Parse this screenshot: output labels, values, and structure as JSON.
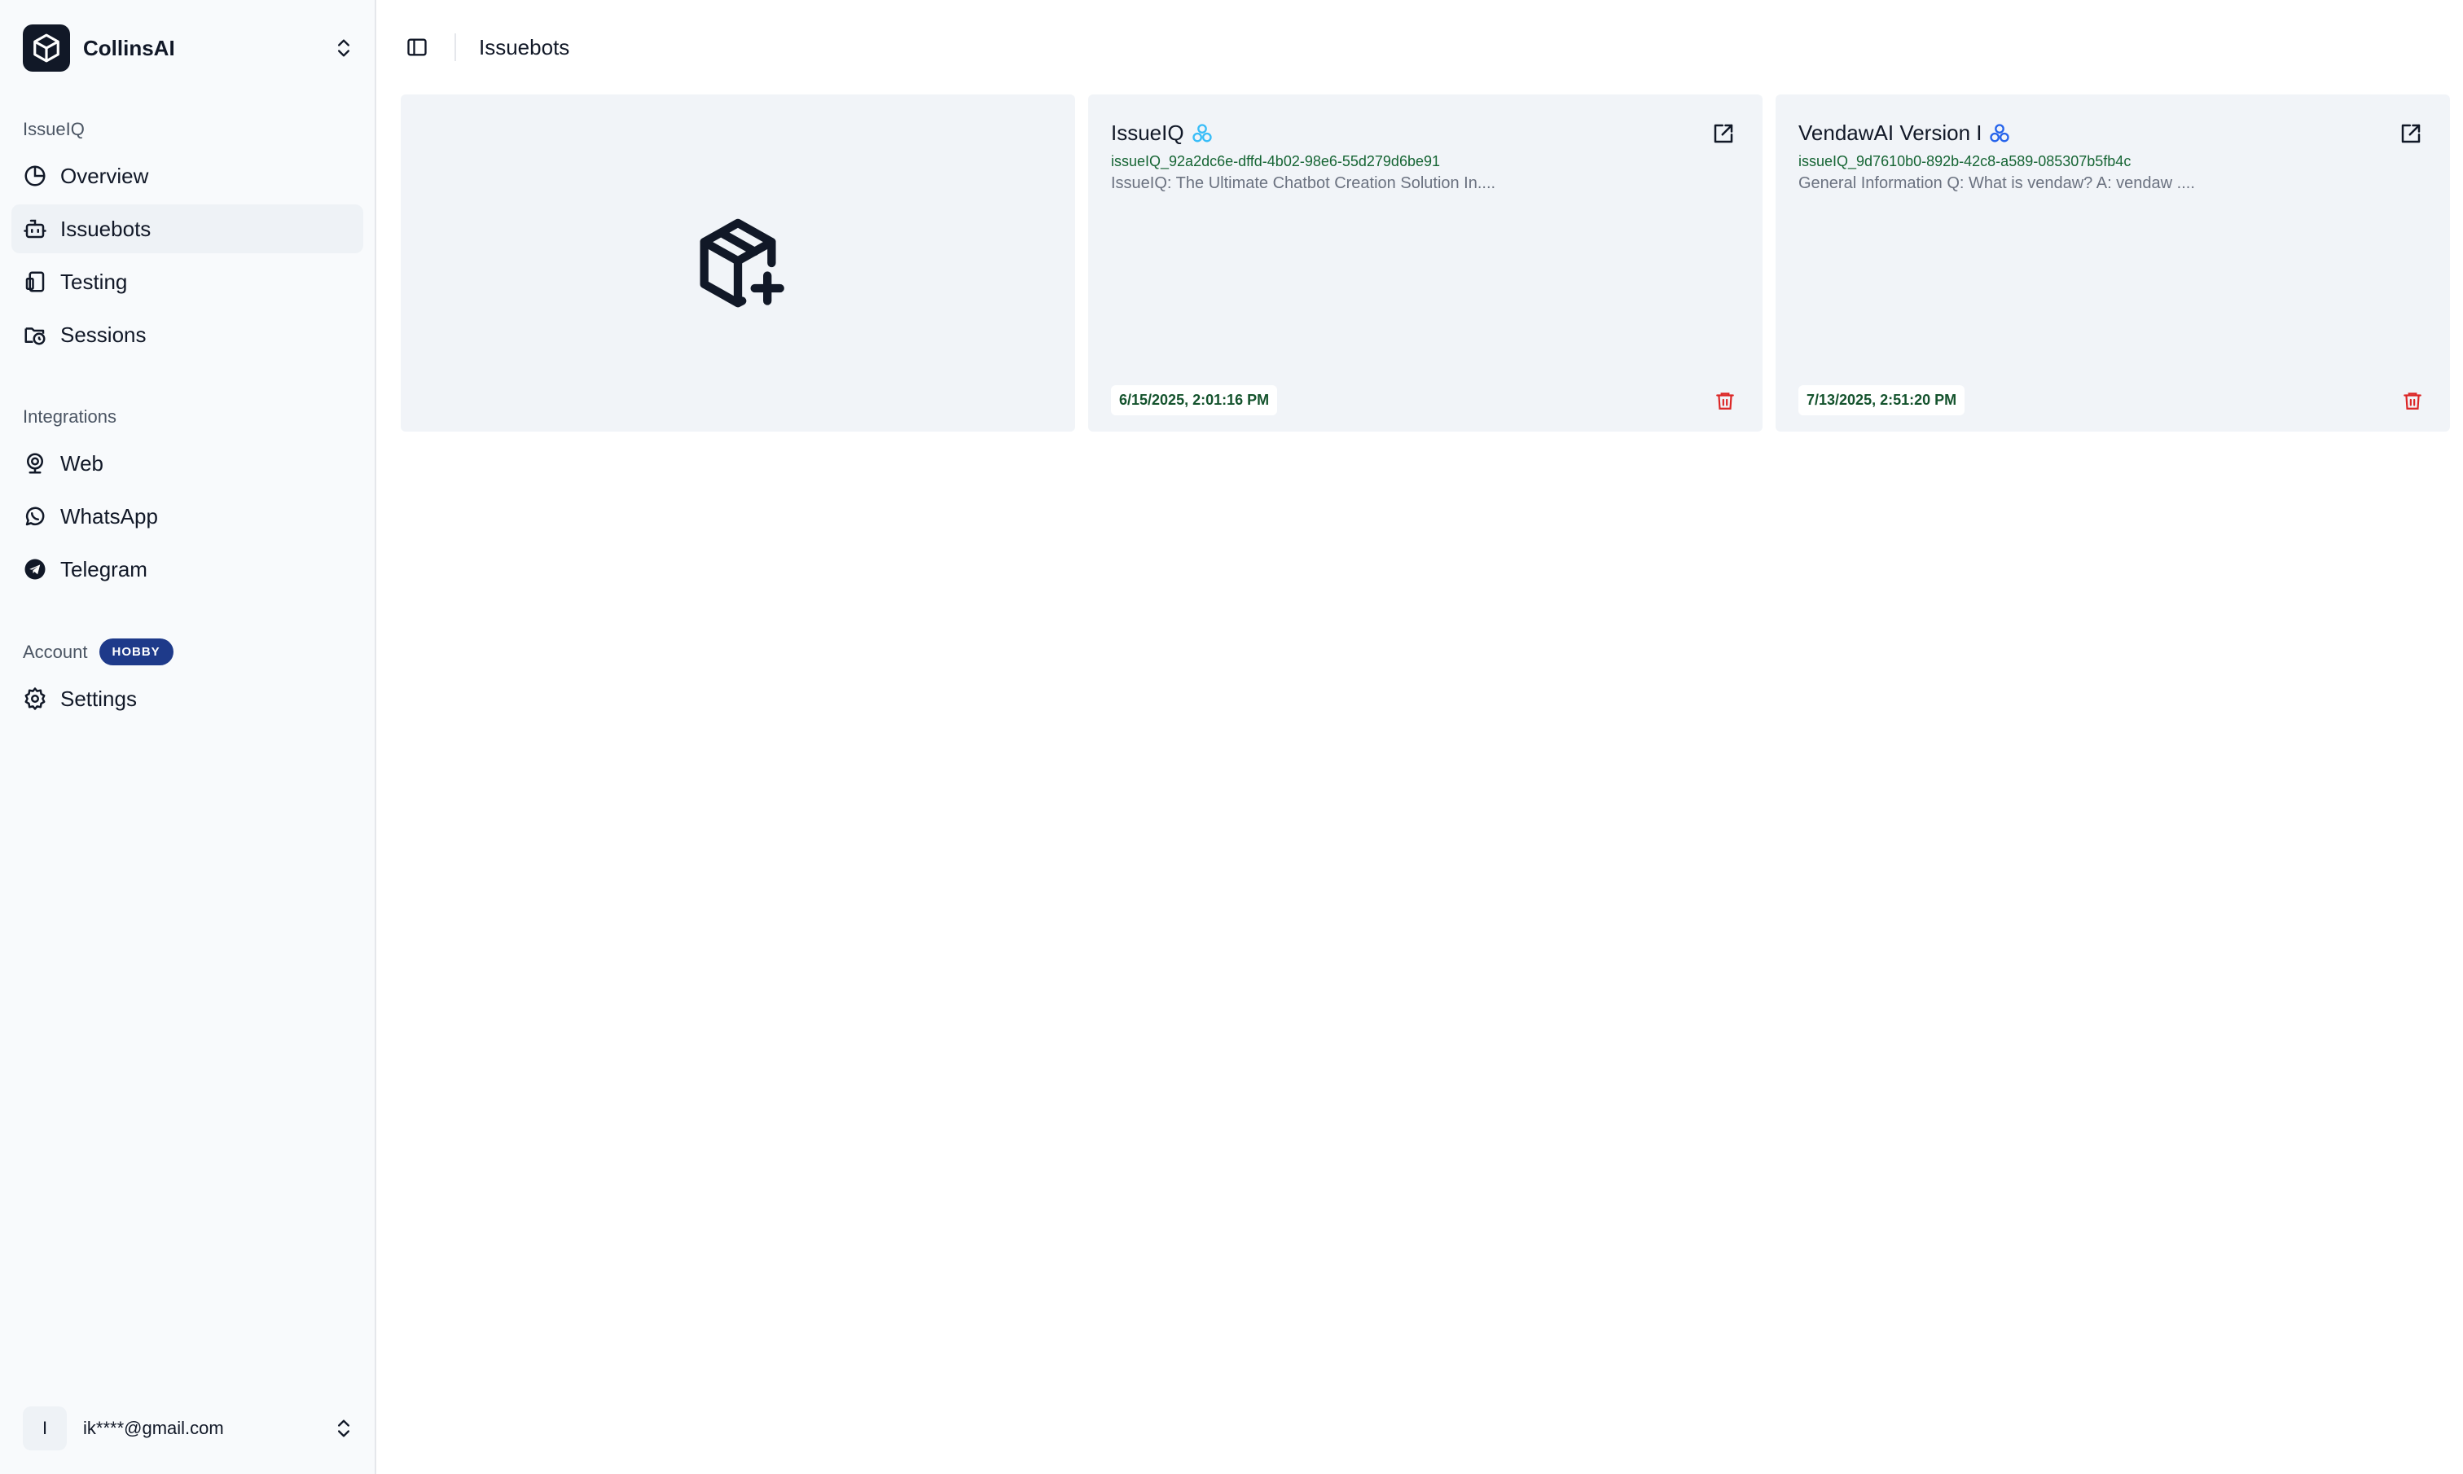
{
  "workspace": {
    "name": "CollinsAI"
  },
  "sidebar": {
    "sections": [
      {
        "label": "IssueIQ"
      },
      {
        "label": "Integrations"
      },
      {
        "label": "Account",
        "badge": "HOBBY"
      }
    ],
    "issueiq_items": [
      {
        "label": "Overview",
        "icon": "pie-chart-icon"
      },
      {
        "label": "Issuebots",
        "icon": "bot-icon",
        "active": true
      },
      {
        "label": "Testing",
        "icon": "book-icon"
      },
      {
        "label": "Sessions",
        "icon": "folder-clock-icon"
      }
    ],
    "integration_items": [
      {
        "label": "Web",
        "icon": "webcam-icon"
      },
      {
        "label": "WhatsApp",
        "icon": "whatsapp-icon"
      },
      {
        "label": "Telegram",
        "icon": "telegram-icon"
      }
    ],
    "account_items": [
      {
        "label": "Settings",
        "icon": "gear-icon"
      }
    ],
    "user": {
      "initial": "I",
      "email": "ik****@gmail.com"
    }
  },
  "header": {
    "breadcrumb": "Issuebots"
  },
  "bots": [
    {
      "name": "IssueIQ",
      "id": "issueIQ_92a2dc6e-dffd-4b02-98e6-55d279d6be91",
      "description": "IssueIQ: The Ultimate Chatbot Creation Solution In....",
      "date": "6/15/2025, 2:01:16 PM",
      "icon_color": "#38bdf8"
    },
    {
      "name": "VendawAI Version I",
      "id": "issueIQ_9d7610b0-892b-42c8-a589-085307b5fb4c",
      "description": "General Information Q: What is vendaw? A: vendaw ....",
      "date": "7/13/2025, 2:51:20 PM",
      "icon_color": "#2563eb"
    }
  ],
  "colors": {
    "accent_badge": "#1e3a8a",
    "delete": "#dc2626",
    "id_text": "#166534"
  }
}
